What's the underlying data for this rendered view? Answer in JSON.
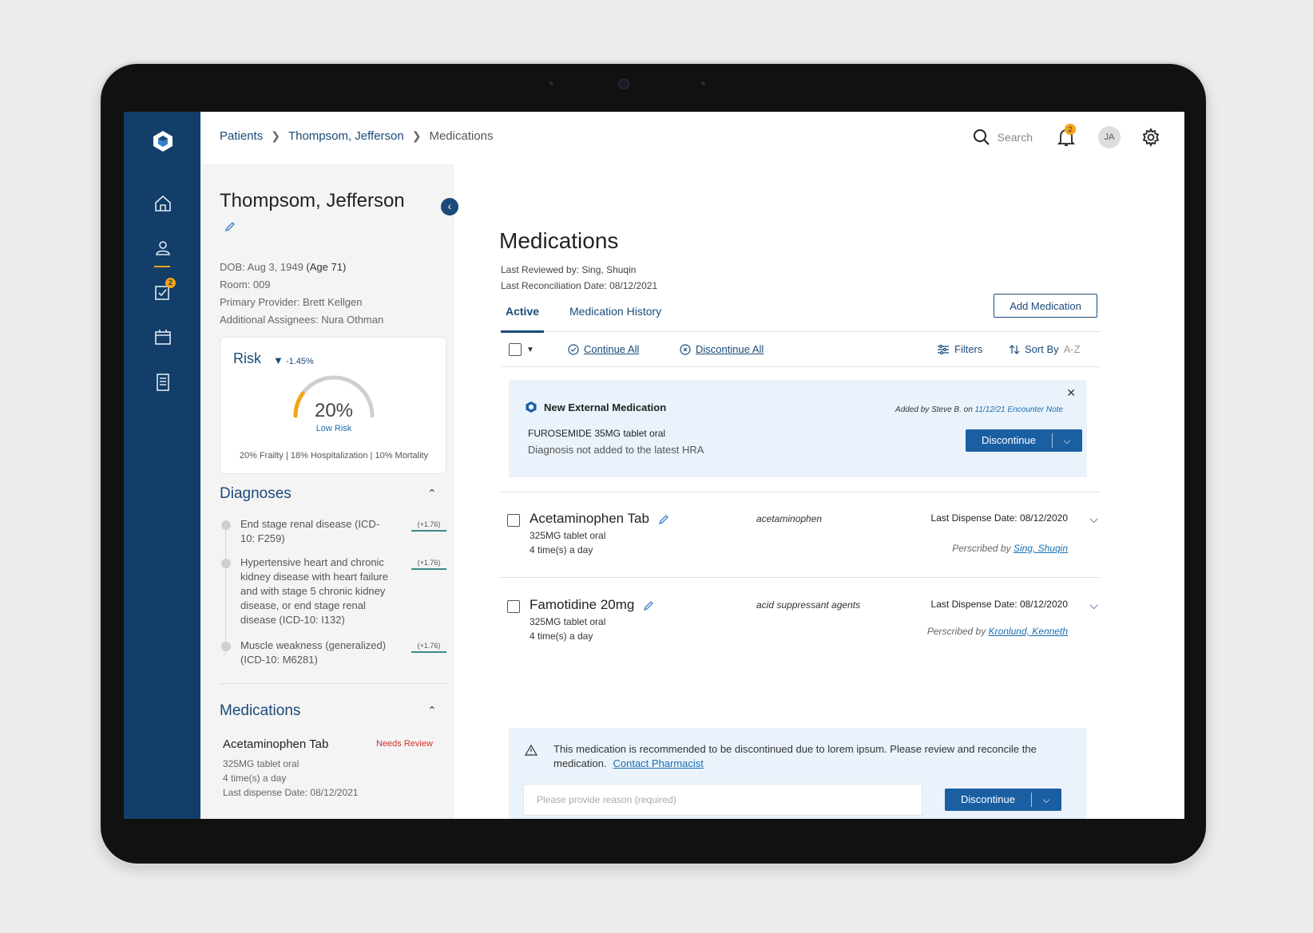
{
  "breadcrumb": [
    "Patients",
    "Thompsom, Jefferson",
    "Medications"
  ],
  "topbar": {
    "search_label": "Search",
    "notification_count": "2",
    "avatar_initials": "JA"
  },
  "nav": {
    "tasks_badge": "2",
    "icons": [
      "home-icon",
      "person-icon",
      "tasks-icon",
      "calendar-icon",
      "document-icon"
    ]
  },
  "patient": {
    "name": "Thompsom, Jefferson",
    "dob_label": "DOB: Aug 3, 1949",
    "age": "(Age 71)",
    "room": "Room: 009",
    "provider": "Primary Provider: Brett Kellgen",
    "assignees": "Additional Assignees: Nura Othman"
  },
  "risk": {
    "title": "Risk",
    "delta": "-1.45%",
    "value": "20%",
    "value_fraction": 0.2,
    "label": "Low Risk",
    "stats": "20% Frailty | 18% Hospitalization | 10% Mortality"
  },
  "diagnoses": {
    "title": "Diagnoses",
    "items": [
      {
        "text": "End stage renal disease (ICD-10: F259)",
        "score": "(+1.76)"
      },
      {
        "text": "Hypertensive heart and chronic kidney disease with heart failure and with stage 5 chronic kidney disease, or end stage renal disease (ICD-10: I132)",
        "score": "(+1.76)"
      },
      {
        "text": "Muscle weakness (generalized) (ICD-10: M6281)",
        "score": "(+1.76)"
      }
    ]
  },
  "left_medications": {
    "title": "Medications",
    "item": {
      "name": "Acetaminophen Tab",
      "flag": "Needs Review",
      "dose": "325MG tablet oral",
      "freq": "4 time(s) a day",
      "last": "Last dispense Date: 08/12/2021"
    }
  },
  "main": {
    "title": "Medications",
    "last_reviewed": "Last Reviewed by:  Sing, Shuqin",
    "last_reconciliation": "Last Reconciliation Date: 08/12/2021",
    "add_button": "Add Medication",
    "tabs": [
      "Active",
      "Medication History"
    ],
    "toolbar": {
      "continue_all": "Continue All",
      "discontinue_all": "Discontinue All",
      "filters": "Filters",
      "sort": "Sort By",
      "sort_value": "A-Z"
    }
  },
  "external": {
    "title": "New External Medication",
    "added_by": "Added by Steve B. on",
    "added_link": "11/12/21 Encounter Note",
    "drug": "FUROSEMIDE 35MG tablet oral",
    "note": "Diagnosis not added to the latest HRA",
    "button": "Discontinue"
  },
  "medications": [
    {
      "name": "Acetaminophen Tab",
      "dose": "325MG tablet oral",
      "freq": "4 time(s) a day",
      "class": "acetaminophen",
      "dispense": "Last Dispense Date: 08/12/2020",
      "prescribed_label": "Perscribed by",
      "prescriber": "Sing, Shuqin"
    },
    {
      "name": "Famotidine 20mg",
      "dose": "325MG tablet oral",
      "freq": "4 time(s) a day",
      "class": "acid suppressant agents",
      "dispense": "Last Dispense Date: 08/12/2020",
      "prescribed_label": "Perscribed by",
      "prescriber": "Kronlund, Kenneth"
    }
  ],
  "warning": {
    "message": "This medication is recommended to be discontinued due to lorem ipsum. Please review and reconcile the medication.",
    "link": "Contact Pharmacist",
    "placeholder": "Please provide reason (required)",
    "button": "Discontinue"
  },
  "colors": {
    "brand": "#123e69",
    "accent": "#f2a516",
    "button": "#1b5fa3",
    "alert": "#d0302b"
  }
}
